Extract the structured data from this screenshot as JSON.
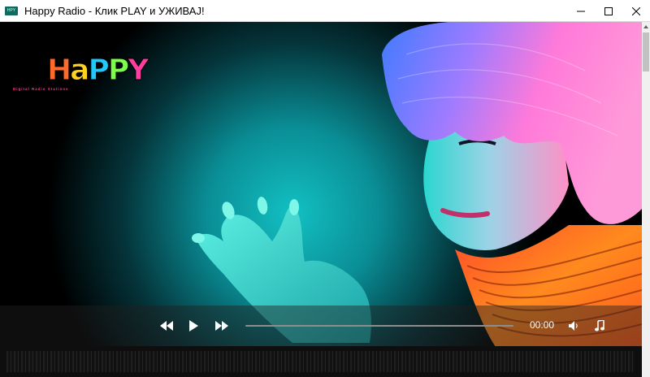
{
  "window": {
    "title": "Happy Radio - Клик PLAY и УЖИВАЈ!",
    "app_icon": "radio-app-icon",
    "controls": [
      "minimize-icon",
      "maximize-icon",
      "close-icon"
    ]
  },
  "logo": {
    "text": "HaPPY",
    "tagline": "Digital Radio Stations",
    "colors": [
      "#ff6a2b",
      "#ffd21f",
      "#1ec9ff",
      "#7cff4a",
      "#ff3ea0"
    ]
  },
  "player": {
    "time": "00:00",
    "progress": 0,
    "buttons": {
      "rewind": "rewind-icon",
      "play": "play-icon",
      "fast_forward": "fast-forward-icon",
      "volume": "volume-icon",
      "playlist": "music-note-icon"
    }
  },
  "colors": {
    "background": "#000000",
    "controls_bar": "#1e1e1e",
    "hair_pink": "#ff7ad9",
    "hair_blue": "#4a7dff",
    "backdrop_cyan": "#0aa6ad",
    "collar_orange": "#ff6a1a"
  }
}
